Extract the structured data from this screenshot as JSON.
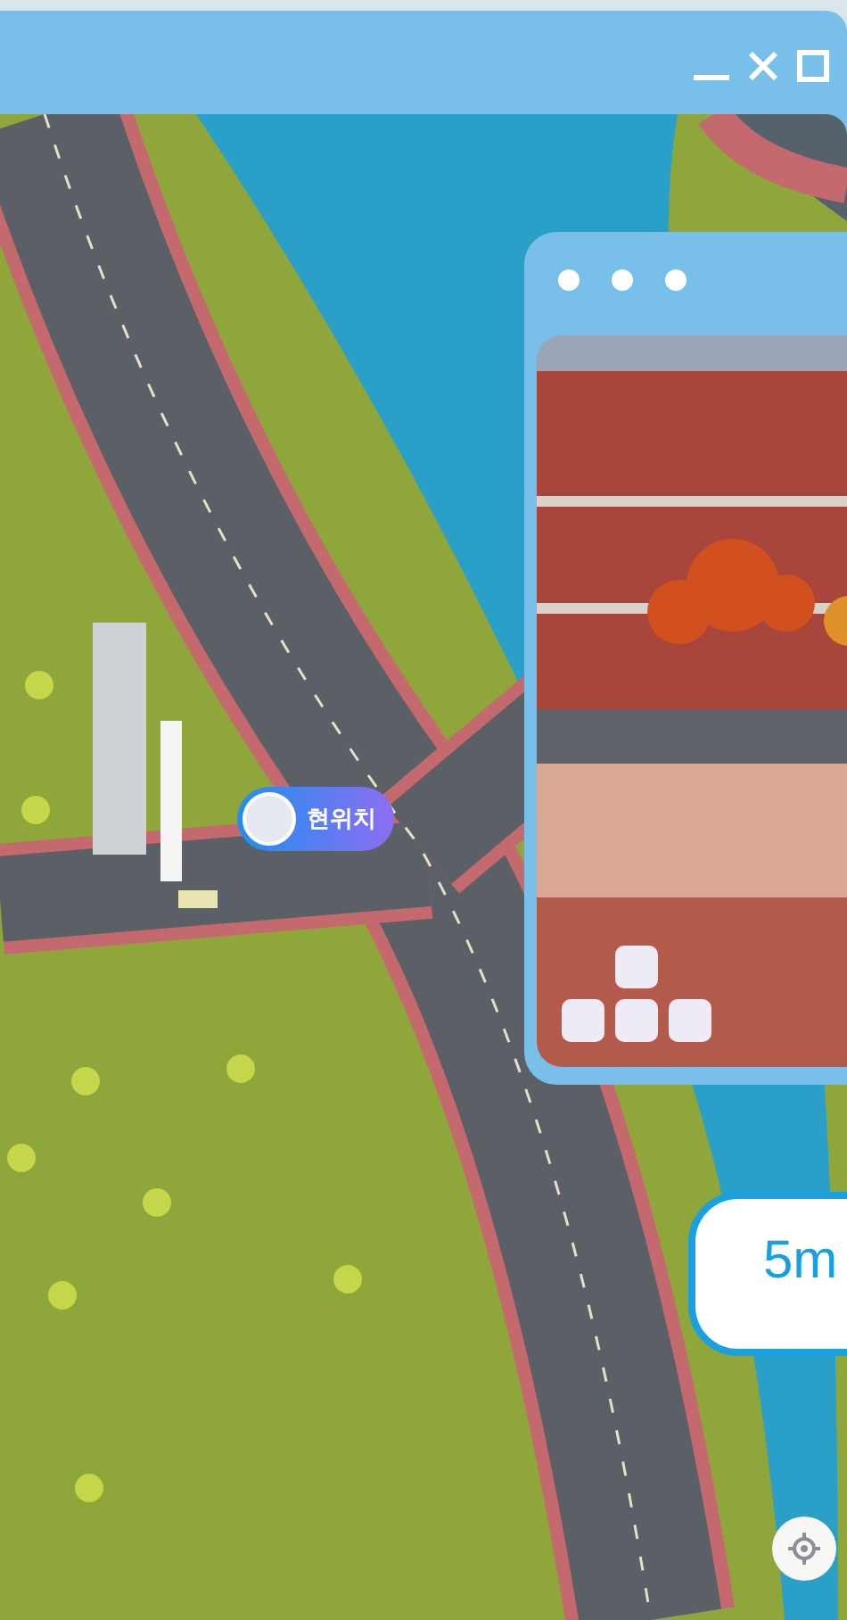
{
  "map": {
    "location_marker": {
      "label": "현위치"
    }
  },
  "distance_card": {
    "text": "5m"
  }
}
